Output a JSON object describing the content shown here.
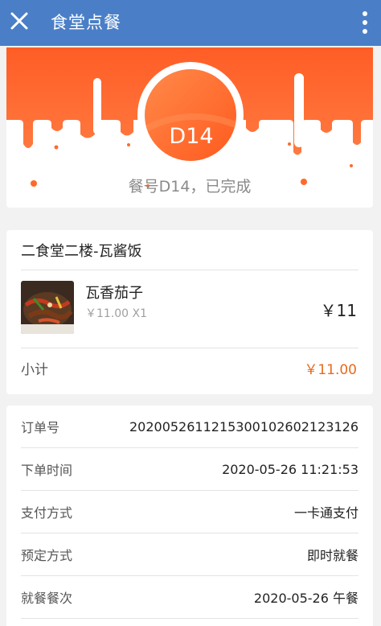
{
  "header": {
    "title": "食堂点餐",
    "close_icon": "close-icon",
    "more_icon": "more-vertical-icon",
    "bg_color": "#4a7fc7"
  },
  "meal": {
    "code": "D14",
    "status": "餐号D14，已完成",
    "accent_color": "#ff6a2b"
  },
  "order": {
    "shop_name": "二食堂二楼-瓦酱饭",
    "items": [
      {
        "name": "瓦香茄子",
        "unit_price_qty": "￥11.00 X1",
        "price": "￥11"
      }
    ],
    "subtotal_label": "小计",
    "subtotal_value": "￥11.00"
  },
  "details": [
    {
      "label": "订单号",
      "value": "2020052611215300102602123126"
    },
    {
      "label": "下单时间",
      "value": "2020-05-26 11:21:53"
    },
    {
      "label": "支付方式",
      "value": "一卡通支付"
    },
    {
      "label": "预定方式",
      "value": "即时就餐"
    },
    {
      "label": "就餐餐次",
      "value": "2020-05-26 午餐"
    }
  ]
}
